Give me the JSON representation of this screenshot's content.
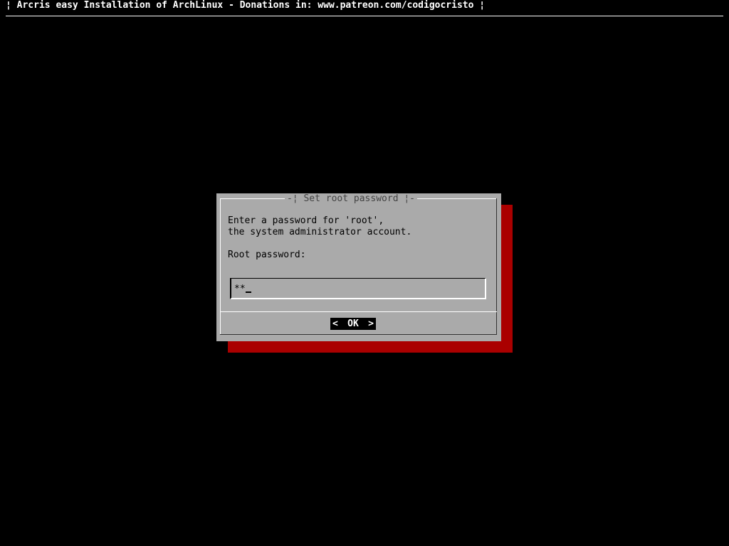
{
  "backtitle": "¦ Arcris easy Installation of ArchLinux - Donations in: www.patreon.com/codigocristo ¦",
  "dialog": {
    "title": "-¦ Set root password ¦-",
    "text_line1": "Enter a password for 'root',",
    "text_line2": "the system administrator account.",
    "field_label": "Root password:",
    "password_mask": "**",
    "ok_left": "<",
    "ok_label": "OK",
    "ok_right": ">"
  },
  "colors": {
    "background": "#000000",
    "dialog": "#aaaaaa",
    "shadow": "#aa0000",
    "button_bg": "#000000",
    "button_fg": "#ffffff"
  }
}
